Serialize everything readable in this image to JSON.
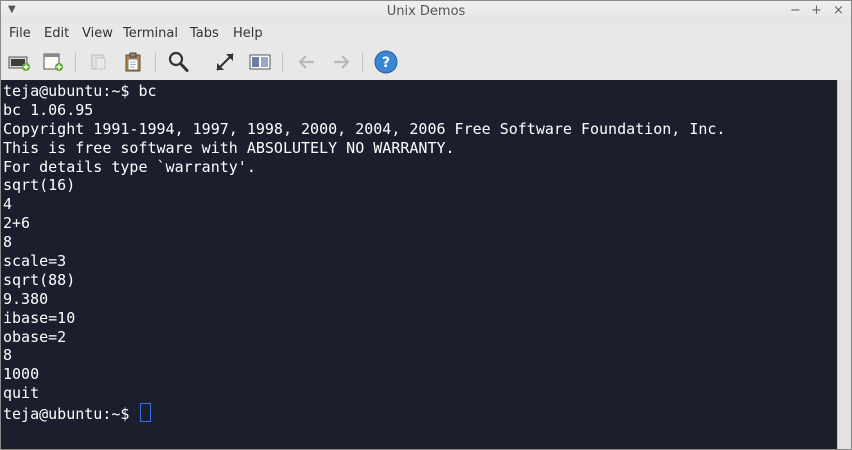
{
  "window": {
    "title": "Unix Demos",
    "controls": {
      "minimize": "−",
      "maximize": "+",
      "close": "×"
    }
  },
  "menu": [
    "File",
    "Edit",
    "View",
    "Terminal",
    "Tabs",
    "Help"
  ],
  "toolbar": {
    "buttons": [
      {
        "icon": "new-tab-icon",
        "enabled": true
      },
      {
        "icon": "new-window-icon",
        "enabled": true
      },
      {
        "icon": "copy-icon",
        "enabled": false
      },
      {
        "icon": "paste-icon",
        "enabled": true
      },
      {
        "icon": "search-icon",
        "enabled": true
      },
      {
        "icon": "fullscreen-icon",
        "enabled": true
      },
      {
        "icon": "preferences-icon",
        "enabled": true
      },
      {
        "icon": "back-arrow-icon",
        "enabled": false
      },
      {
        "icon": "forward-arrow-icon",
        "enabled": false
      },
      {
        "icon": "help-icon",
        "enabled": true
      }
    ],
    "help_label": "?"
  },
  "terminal": {
    "lines": [
      "teja@ubuntu:~$ bc",
      "bc 1.06.95",
      "Copyright 1991-1994, 1997, 1998, 2000, 2004, 2006 Free Software Foundation, Inc.",
      "This is free software with ABSOLUTELY NO WARRANTY.",
      "For details type `warranty'.",
      "sqrt(16)",
      "4",
      "2+6",
      "8",
      "scale=3",
      "sqrt(88)",
      "9.380",
      "ibase=10",
      "obase=2",
      "8",
      "1000",
      "quit"
    ],
    "prompt": "teja@ubuntu:~$ ",
    "colors": {
      "background": "#1b1e2c",
      "foreground": "#ffffff",
      "cursor": "#3a6fe0"
    }
  }
}
